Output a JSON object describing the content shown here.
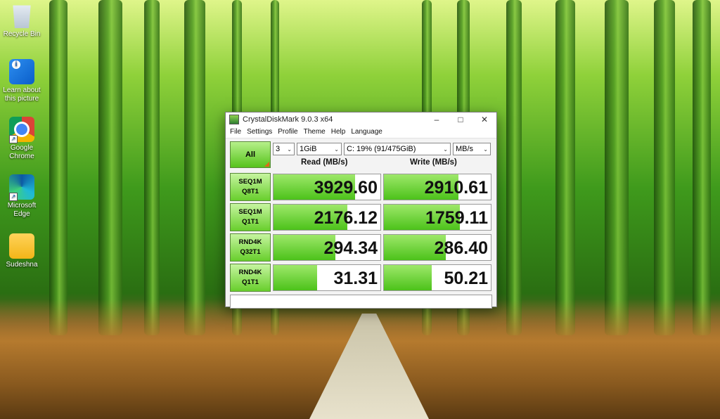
{
  "desktop": {
    "icons": [
      {
        "label": "Recycle Bin"
      },
      {
        "label": "Learn about this picture"
      },
      {
        "label": "Google Chrome"
      },
      {
        "label": "Microsoft Edge"
      },
      {
        "label": "Sudeshna"
      }
    ]
  },
  "window": {
    "title": "CrystalDiskMark 9.0.3 x64",
    "menu": [
      "File",
      "Settings",
      "Profile",
      "Theme",
      "Help",
      "Language"
    ],
    "all_label": "All",
    "count": "3",
    "size": "1GiB",
    "drive": "C: 19% (91/475GiB)",
    "unit": "MB/s",
    "read_header": "Read (MB/s)",
    "write_header": "Write (MB/s)",
    "tests": [
      {
        "line1": "SEQ1M",
        "line2": "Q8T1",
        "read": "3929.60",
        "write": "2910.61",
        "read_fill": 0.76,
        "write_fill": 0.7
      },
      {
        "line1": "SEQ1M",
        "line2": "Q1T1",
        "read": "2176.12",
        "write": "1759.11",
        "read_fill": 0.69,
        "write_fill": 0.71
      },
      {
        "line1": "RND4K",
        "line2": "Q32T1",
        "read": "294.34",
        "write": "286.40",
        "read_fill": 0.58,
        "write_fill": 0.58
      },
      {
        "line1": "RND4K",
        "line2": "Q1T1",
        "read": "31.31",
        "write": "50.21",
        "read_fill": 0.41,
        "write_fill": 0.45
      }
    ],
    "comment": ""
  }
}
